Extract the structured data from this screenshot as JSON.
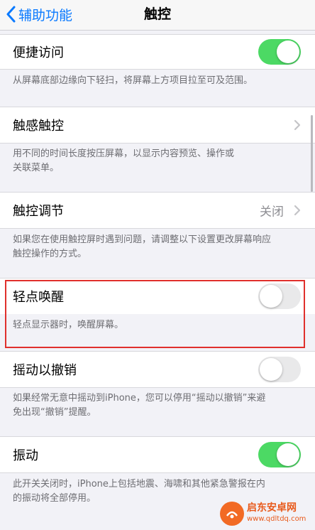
{
  "nav": {
    "back_label": "辅助功能",
    "title": "触控"
  },
  "settings": [
    {
      "label": "便捷访问",
      "control": "toggle",
      "on": true,
      "description": [
        "从屏幕底部边缘向下轻扫，将屏幕上方项目拉至可及范围。"
      ]
    },
    {
      "label": "触感触控",
      "control": "chevron",
      "description": [
        "用不同的时间长度按压屏幕，以显示内容预览、操作或",
        "关联菜单。"
      ]
    },
    {
      "label": "触控调节",
      "control": "chevron",
      "value": "关闭",
      "description": [
        "如果您在使用触控屏时遇到问题，请调整以下设置更改屏幕响应",
        "触控操作的方式。"
      ]
    },
    {
      "label": "轻点唤醒",
      "control": "toggle",
      "on": false,
      "description": [
        "轻点显示器时，唤醒屏幕。"
      ]
    },
    {
      "label": "摇动以撤销",
      "control": "toggle",
      "on": false,
      "description": [
        "如果经常无意中摇动到iPhone，您可以停用“摇动以撤销”来避",
        "免出现“撤销”提醒。"
      ]
    },
    {
      "label": "振动",
      "control": "toggle",
      "on": true,
      "description": [
        "此开关关闭时，iPhone上包括地震、海啸和其他紧急警报在内",
        "的振动将全部停用。"
      ]
    }
  ],
  "colors": {
    "accent": "#0a7aff",
    "toggle_on": "#4cd964",
    "highlight": "#e0302c"
  },
  "watermark": {
    "name": "启东安卓网",
    "url": "www.qdltdq.com"
  }
}
